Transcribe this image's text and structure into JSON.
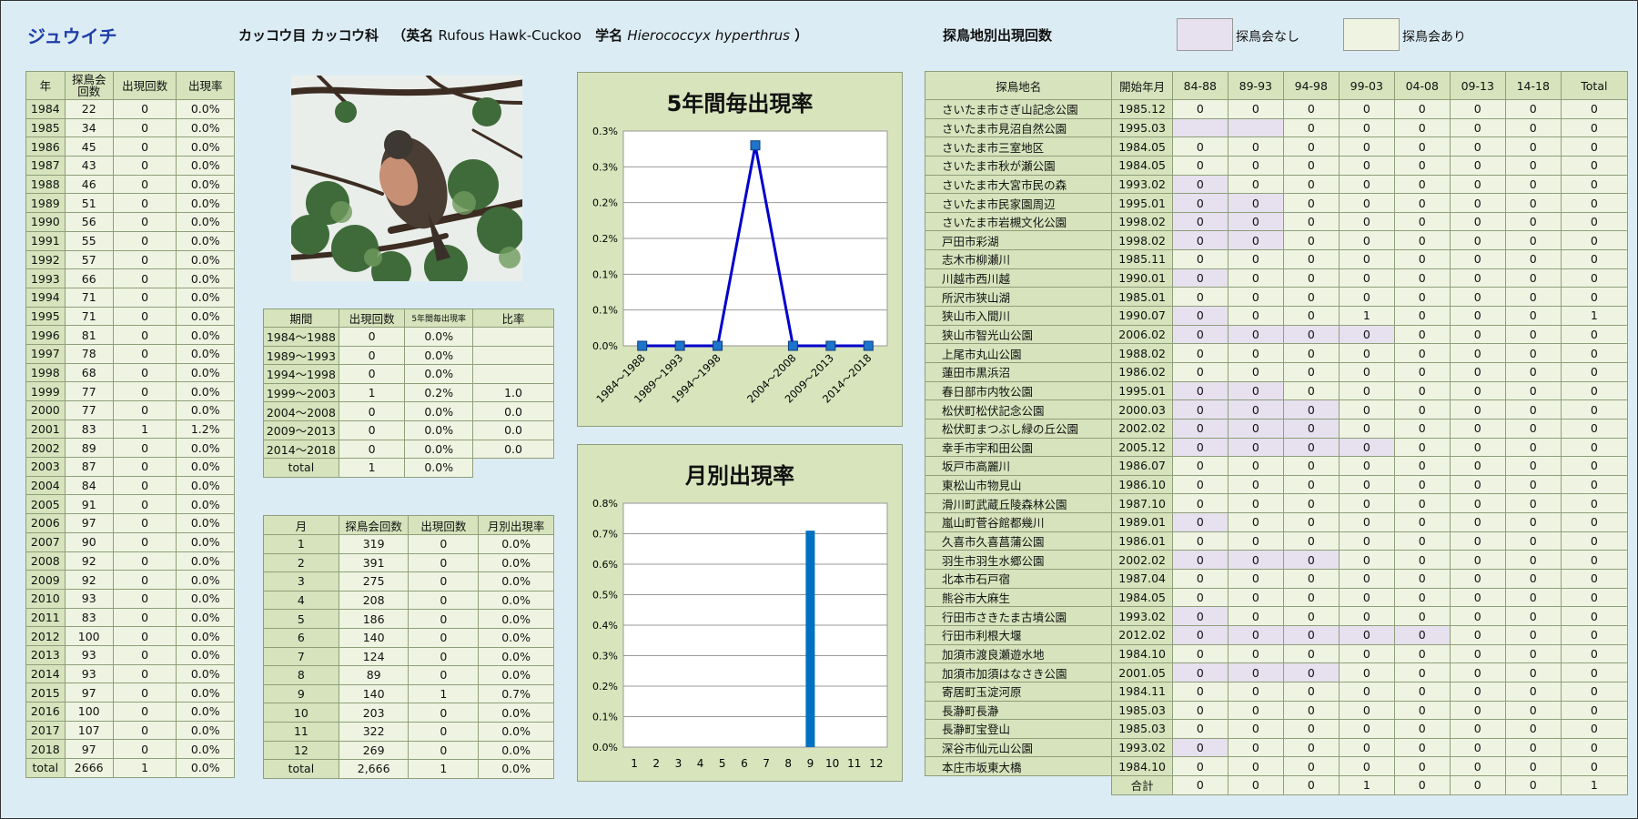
{
  "header": {
    "species_jp": "ジュウイチ",
    "order_family": "カッコウ目 カッコウ科",
    "en_prefix": "（英名 ",
    "en_name": "Rufous Hawk-Cuckoo",
    "sci_prefix": "学名 ",
    "sci_name": "Hierococcyx hyperthrus",
    "sci_suffix": " ）",
    "site_title": "探鳥地別出現回数",
    "legend_no": "探鳥会なし",
    "legend_yes": "探鳥会あり"
  },
  "colors": {
    "no_event": "#e6e0ef",
    "event": "#eef4e1",
    "header": "#d6e3bc",
    "line": "#0000cc",
    "bar": "#0070c0"
  },
  "year_table": {
    "headers": [
      "年",
      "探鳥会\n回数",
      "出現回数",
      "出現率"
    ],
    "rows": [
      [
        "1984",
        "22",
        "0",
        "0.0%"
      ],
      [
        "1985",
        "34",
        "0",
        "0.0%"
      ],
      [
        "1986",
        "45",
        "0",
        "0.0%"
      ],
      [
        "1987",
        "43",
        "0",
        "0.0%"
      ],
      [
        "1988",
        "46",
        "0",
        "0.0%"
      ],
      [
        "1989",
        "51",
        "0",
        "0.0%"
      ],
      [
        "1990",
        "56",
        "0",
        "0.0%"
      ],
      [
        "1991",
        "55",
        "0",
        "0.0%"
      ],
      [
        "1992",
        "57",
        "0",
        "0.0%"
      ],
      [
        "1993",
        "66",
        "0",
        "0.0%"
      ],
      [
        "1994",
        "71",
        "0",
        "0.0%"
      ],
      [
        "1995",
        "71",
        "0",
        "0.0%"
      ],
      [
        "1996",
        "81",
        "0",
        "0.0%"
      ],
      [
        "1997",
        "78",
        "0",
        "0.0%"
      ],
      [
        "1998",
        "68",
        "0",
        "0.0%"
      ],
      [
        "1999",
        "77",
        "0",
        "0.0%"
      ],
      [
        "2000",
        "77",
        "0",
        "0.0%"
      ],
      [
        "2001",
        "83",
        "1",
        "1.2%"
      ],
      [
        "2002",
        "89",
        "0",
        "0.0%"
      ],
      [
        "2003",
        "87",
        "0",
        "0.0%"
      ],
      [
        "2004",
        "84",
        "0",
        "0.0%"
      ],
      [
        "2005",
        "91",
        "0",
        "0.0%"
      ],
      [
        "2006",
        "97",
        "0",
        "0.0%"
      ],
      [
        "2007",
        "90",
        "0",
        "0.0%"
      ],
      [
        "2008",
        "92",
        "0",
        "0.0%"
      ],
      [
        "2009",
        "92",
        "0",
        "0.0%"
      ],
      [
        "2010",
        "93",
        "0",
        "0.0%"
      ],
      [
        "2011",
        "83",
        "0",
        "0.0%"
      ],
      [
        "2012",
        "100",
        "0",
        "0.0%"
      ],
      [
        "2013",
        "93",
        "0",
        "0.0%"
      ],
      [
        "2014",
        "93",
        "0",
        "0.0%"
      ],
      [
        "2015",
        "97",
        "0",
        "0.0%"
      ],
      [
        "2016",
        "100",
        "0",
        "0.0%"
      ],
      [
        "2017",
        "107",
        "0",
        "0.0%"
      ],
      [
        "2018",
        "97",
        "0",
        "0.0%"
      ]
    ],
    "total": [
      "total",
      "2666",
      "1",
      "0.0%"
    ]
  },
  "period_table": {
    "headers": [
      "期間",
      "出現回数",
      "5年間毎出現率",
      "比率"
    ],
    "rows": [
      [
        "1984～1988",
        "0",
        "0.0%",
        ""
      ],
      [
        "1989～1993",
        "0",
        "0.0%",
        ""
      ],
      [
        "1994～1998",
        "0",
        "0.0%",
        ""
      ],
      [
        "1999～2003",
        "1",
        "0.2%",
        "1.0"
      ],
      [
        "2004～2008",
        "0",
        "0.0%",
        "0.0"
      ],
      [
        "2009～2013",
        "0",
        "0.0%",
        "0.0"
      ],
      [
        "2014～2018",
        "0",
        "0.0%",
        "0.0"
      ]
    ],
    "total": [
      "total",
      "1",
      "0.0%"
    ]
  },
  "month_table": {
    "headers": [
      "月",
      "探鳥会回数",
      "出現回数",
      "月別出現率"
    ],
    "rows": [
      [
        "1",
        "319",
        "0",
        "0.0%"
      ],
      [
        "2",
        "391",
        "0",
        "0.0%"
      ],
      [
        "3",
        "275",
        "0",
        "0.0%"
      ],
      [
        "4",
        "208",
        "0",
        "0.0%"
      ],
      [
        "5",
        "186",
        "0",
        "0.0%"
      ],
      [
        "6",
        "140",
        "0",
        "0.0%"
      ],
      [
        "7",
        "124",
        "0",
        "0.0%"
      ],
      [
        "8",
        "89",
        "0",
        "0.0%"
      ],
      [
        "9",
        "140",
        "1",
        "0.7%"
      ],
      [
        "10",
        "203",
        "0",
        "0.0%"
      ],
      [
        "11",
        "322",
        "0",
        "0.0%"
      ],
      [
        "12",
        "269",
        "0",
        "0.0%"
      ]
    ],
    "total": [
      "total",
      "2,666",
      "1",
      "0.0%"
    ]
  },
  "chart_data": [
    {
      "type": "line",
      "title": "5年間毎出現率",
      "categories": [
        "1984～1988",
        "1989～1993",
        "1994～1998",
        "1999～2003",
        "2004～2008",
        "2009～2013",
        "2014～2018"
      ],
      "values": [
        0,
        0,
        0,
        0.28,
        0,
        0,
        0
      ],
      "missing_index": 3,
      "yticks": [
        "0.0%",
        "0.1%",
        "0.1%",
        "0.2%",
        "0.2%",
        "0.3%",
        "0.3%"
      ],
      "ylim": [
        0,
        0.3
      ]
    },
    {
      "type": "bar",
      "title": "月別出現率",
      "categories": [
        "1",
        "2",
        "3",
        "4",
        "5",
        "6",
        "7",
        "8",
        "9",
        "10",
        "11",
        "12"
      ],
      "values": [
        0,
        0,
        0,
        0,
        0,
        0,
        0,
        0,
        0.71,
        0,
        0,
        0
      ],
      "yticks": [
        "0.0%",
        "0.1%",
        "0.2%",
        "0.3%",
        "0.4%",
        "0.5%",
        "0.6%",
        "0.7%",
        "0.8%"
      ],
      "ylim": [
        0,
        0.8
      ]
    }
  ],
  "site_table": {
    "headers": [
      "探鳥地名",
      "開始年月",
      "84-88",
      "89-93",
      "94-98",
      "99-03",
      "04-08",
      "09-13",
      "14-18",
      "Total"
    ],
    "rows": [
      {
        "name": "さいたま市さぎ山記念公園",
        "start": "1985.12",
        "vals": [
          "0",
          "0",
          "0",
          "0",
          "0",
          "0",
          "0",
          "0"
        ],
        "p": []
      },
      {
        "name": "さいたま市見沼自然公園",
        "start": "1995.03",
        "vals": [
          "",
          "",
          "0",
          "0",
          "0",
          "0",
          "0",
          "0"
        ],
        "p": [
          0,
          1
        ]
      },
      {
        "name": "さいたま市三室地区",
        "start": "1984.05",
        "vals": [
          "0",
          "0",
          "0",
          "0",
          "0",
          "0",
          "0",
          "0"
        ],
        "p": []
      },
      {
        "name": "さいたま市秋が瀬公園",
        "start": "1984.05",
        "vals": [
          "0",
          "0",
          "0",
          "0",
          "0",
          "0",
          "0",
          "0"
        ],
        "p": []
      },
      {
        "name": "さいたま市大宮市民の森",
        "start": "1993.02",
        "vals": [
          "0",
          "0",
          "0",
          "0",
          "0",
          "0",
          "0",
          "0"
        ],
        "p": [
          0
        ]
      },
      {
        "name": "さいたま市民家園周辺",
        "start": "1995.01",
        "vals": [
          "0",
          "0",
          "0",
          "0",
          "0",
          "0",
          "0",
          "0"
        ],
        "p": [
          0,
          1
        ]
      },
      {
        "name": "さいたま市岩槻文化公園",
        "start": "1998.02",
        "vals": [
          "0",
          "0",
          "0",
          "0",
          "0",
          "0",
          "0",
          "0"
        ],
        "p": [
          0,
          1
        ]
      },
      {
        "name": "戸田市彩湖",
        "start": "1998.02",
        "vals": [
          "0",
          "0",
          "0",
          "0",
          "0",
          "0",
          "0",
          "0"
        ],
        "p": [
          0,
          1
        ]
      },
      {
        "name": "志木市柳瀬川",
        "start": "1985.11",
        "vals": [
          "0",
          "0",
          "0",
          "0",
          "0",
          "0",
          "0",
          "0"
        ],
        "p": []
      },
      {
        "name": "川越市西川越",
        "start": "1990.01",
        "vals": [
          "0",
          "0",
          "0",
          "0",
          "0",
          "0",
          "0",
          "0"
        ],
        "p": [
          0
        ]
      },
      {
        "name": "所沢市狭山湖",
        "start": "1985.01",
        "vals": [
          "0",
          "0",
          "0",
          "0",
          "0",
          "0",
          "0",
          "0"
        ],
        "p": []
      },
      {
        "name": "狭山市入間川",
        "start": "1990.07",
        "vals": [
          "0",
          "0",
          "0",
          "1",
          "0",
          "0",
          "0",
          "1"
        ],
        "p": [
          0
        ]
      },
      {
        "name": "狭山市智光山公園",
        "start": "2006.02",
        "vals": [
          "0",
          "0",
          "0",
          "0",
          "0",
          "0",
          "0",
          "0"
        ],
        "p": [
          0,
          1,
          2,
          3
        ]
      },
      {
        "name": "上尾市丸山公園",
        "start": "1988.02",
        "vals": [
          "0",
          "0",
          "0",
          "0",
          "0",
          "0",
          "0",
          "0"
        ],
        "p": []
      },
      {
        "name": "蓮田市黒浜沼",
        "start": "1986.02",
        "vals": [
          "0",
          "0",
          "0",
          "0",
          "0",
          "0",
          "0",
          "0"
        ],
        "p": []
      },
      {
        "name": "春日部市内牧公園",
        "start": "1995.01",
        "vals": [
          "0",
          "0",
          "0",
          "0",
          "0",
          "0",
          "0",
          "0"
        ],
        "p": [
          0,
          1
        ]
      },
      {
        "name": "松伏町松伏記念公園",
        "start": "2000.03",
        "vals": [
          "0",
          "0",
          "0",
          "0",
          "0",
          "0",
          "0",
          "0"
        ],
        "p": [
          0,
          1,
          2
        ]
      },
      {
        "name": "松伏町まつぶし緑の丘公園",
        "start": "2002.02",
        "vals": [
          "0",
          "0",
          "0",
          "0",
          "0",
          "0",
          "0",
          "0"
        ],
        "p": [
          0,
          1,
          2
        ]
      },
      {
        "name": "幸手市宇和田公園",
        "start": "2005.12",
        "vals": [
          "0",
          "0",
          "0",
          "0",
          "0",
          "0",
          "0",
          "0"
        ],
        "p": [
          0,
          1,
          2,
          3
        ]
      },
      {
        "name": "坂戸市高麗川",
        "start": "1986.07",
        "vals": [
          "0",
          "0",
          "0",
          "0",
          "0",
          "0",
          "0",
          "0"
        ],
        "p": []
      },
      {
        "name": "東松山市物見山",
        "start": "1986.10",
        "vals": [
          "0",
          "0",
          "0",
          "0",
          "0",
          "0",
          "0",
          "0"
        ],
        "p": []
      },
      {
        "name": "滑川町武蔵丘陵森林公園",
        "start": "1987.10",
        "vals": [
          "0",
          "0",
          "0",
          "0",
          "0",
          "0",
          "0",
          "0"
        ],
        "p": []
      },
      {
        "name": "嵐山町菅谷館都幾川",
        "start": "1989.01",
        "vals": [
          "0",
          "0",
          "0",
          "0",
          "0",
          "0",
          "0",
          "0"
        ],
        "p": [
          0
        ]
      },
      {
        "name": "久喜市久喜菖蒲公園",
        "start": "1986.01",
        "vals": [
          "0",
          "0",
          "0",
          "0",
          "0",
          "0",
          "0",
          "0"
        ],
        "p": []
      },
      {
        "name": "羽生市羽生水郷公園",
        "start": "2002.02",
        "vals": [
          "0",
          "0",
          "0",
          "0",
          "0",
          "0",
          "0",
          "0"
        ],
        "p": [
          0,
          1,
          2
        ]
      },
      {
        "name": "北本市石戸宿",
        "start": "1987.04",
        "vals": [
          "0",
          "0",
          "0",
          "0",
          "0",
          "0",
          "0",
          "0"
        ],
        "p": []
      },
      {
        "name": "熊谷市大麻生",
        "start": "1984.05",
        "vals": [
          "0",
          "0",
          "0",
          "0",
          "0",
          "0",
          "0",
          "0"
        ],
        "p": []
      },
      {
        "name": "行田市さきたま古墳公園",
        "start": "1993.02",
        "vals": [
          "0",
          "0",
          "0",
          "0",
          "0",
          "0",
          "0",
          "0"
        ],
        "p": [
          0
        ]
      },
      {
        "name": "行田市利根大堰",
        "start": "2012.02",
        "vals": [
          "0",
          "0",
          "0",
          "0",
          "0",
          "0",
          "0",
          "0"
        ],
        "p": [
          0,
          1,
          2,
          3,
          4
        ]
      },
      {
        "name": "加須市渡良瀬遊水地",
        "start": "1984.10",
        "vals": [
          "0",
          "0",
          "0",
          "0",
          "0",
          "0",
          "0",
          "0"
        ],
        "p": []
      },
      {
        "name": "加須市加須はなさき公園",
        "start": "2001.05",
        "vals": [
          "0",
          "0",
          "0",
          "0",
          "0",
          "0",
          "0",
          "0"
        ],
        "p": [
          0,
          1,
          2
        ]
      },
      {
        "name": "寄居町玉淀河原",
        "start": "1984.11",
        "vals": [
          "0",
          "0",
          "0",
          "0",
          "0",
          "0",
          "0",
          "0"
        ],
        "p": []
      },
      {
        "name": "長瀞町長瀞",
        "start": "1985.03",
        "vals": [
          "0",
          "0",
          "0",
          "0",
          "0",
          "0",
          "0",
          "0"
        ],
        "p": []
      },
      {
        "name": "長瀞町宝登山",
        "start": "1985.03",
        "vals": [
          "0",
          "0",
          "0",
          "0",
          "0",
          "0",
          "0",
          "0"
        ],
        "p": []
      },
      {
        "name": "深谷市仙元山公園",
        "start": "1993.02",
        "vals": [
          "0",
          "0",
          "0",
          "0",
          "0",
          "0",
          "0",
          "0"
        ],
        "p": [
          0
        ]
      },
      {
        "name": "本庄市坂東大橋",
        "start": "1984.10",
        "vals": [
          "0",
          "0",
          "0",
          "0",
          "0",
          "0",
          "0",
          "0"
        ],
        "p": []
      }
    ],
    "total_label": "合計",
    "total": [
      "0",
      "0",
      "0",
      "1",
      "0",
      "0",
      "0",
      "1"
    ]
  }
}
